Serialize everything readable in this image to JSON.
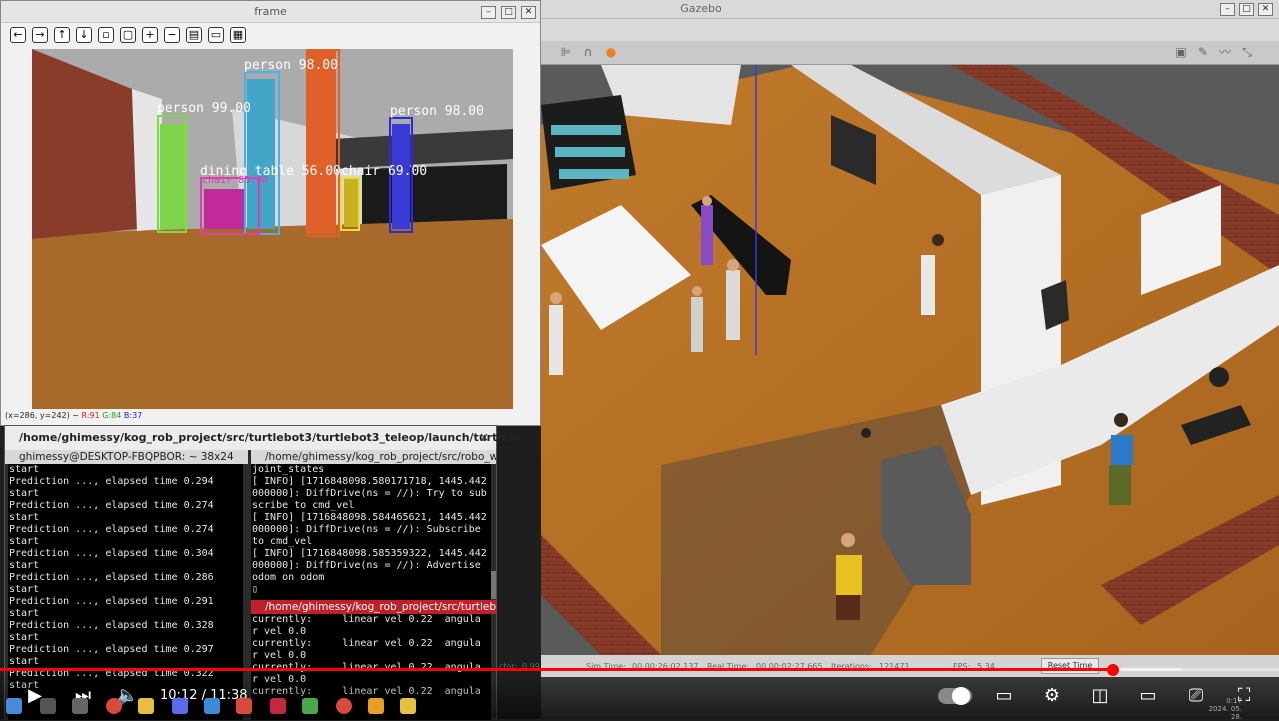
{
  "gazebo": {
    "title": "Gazebo",
    "status": {
      "factor_label": "ctor:",
      "factor_value": "0.99",
      "sim_time_label": "Sim Time:",
      "sim_time_value": "00 00:26:02.137",
      "real_time_label": "Real Time:",
      "real_time_value": "00 00:02:27.665",
      "iterations_label": "Iterations:",
      "iterations_value": "121471",
      "fps_label": "FPS:",
      "fps_value": "5.34",
      "reset_label": "Reset Time"
    }
  },
  "frame": {
    "title": "frame",
    "pixel_info": {
      "coords": "(x=286, y=242) ~",
      "r": "R:91",
      "g": "G:84",
      "b": "B:37"
    },
    "detections": [
      {
        "label": "person 99.00",
        "color": "#7cdc3a"
      },
      {
        "label": "person 98.00",
        "color": "#43b4e8"
      },
      {
        "label": "person 98.00",
        "color": "#2a2ad6"
      },
      {
        "label": "dining table 56.00",
        "color": "#e03cb4"
      },
      {
        "label": "chair 69.00",
        "color": "#e8e030"
      },
      {
        "label": "chair 85.00",
        "color": "#e03cb4"
      }
    ]
  },
  "terminal": {
    "title": "/home/ghimessy/kog_rob_project/src/turtlebot3/turtlebot3_teleop/launch/turtleb...",
    "close": "×",
    "left_pane": {
      "header": "ghimessy@DESKTOP-FBQPBOR: ~ 38x24",
      "lines": [
        "start",
        "Prediction ..., elapsed time 0.294",
        "start",
        "Prediction ..., elapsed time 0.274",
        "start",
        "Prediction ..., elapsed time 0.274",
        "start",
        "Prediction ..., elapsed time 0.304",
        "start",
        "Prediction ..., elapsed time 0.286",
        "start",
        "Prediction ..., elapsed time 0.291",
        "start",
        "Prediction ..., elapsed time 0.328",
        "start",
        "Prediction ..., elapsed time 0.297",
        "start",
        "Prediction ..., elapsed time 0.322",
        "start"
      ]
    },
    "right_top_pane": {
      "header": "/home/ghimessy/kog_rob_project/src/robo_worl",
      "lines": [
        "joint_states",
        "[ INFO] [1716848098.580171718, 1445.442",
        "000000]: DiffDrive(ns = //): Try to sub",
        "scribe to cmd_vel",
        "[ INFO] [1716848098.584465621, 1445.442",
        "000000]: DiffDrive(ns = //): Subscribe",
        "to cmd_vel",
        "[ INFO] [1716848098.585359322, 1445.442",
        "000000]: DiffDrive(ns = //): Advertise",
        "odom on odom",
        "▯"
      ]
    },
    "right_bottom_pane": {
      "header": "/home/ghimessy/kog_rob_project/src/turtlebot3",
      "lines": [
        "currently:     linear vel 0.22  angula",
        "r vel 0.0",
        "currently:     linear vel 0.22  angula",
        "r vel 0.0",
        "currently:     linear vel 0.22  angula",
        "r vel 0.0",
        "currently:     linear vel 0.22  angula"
      ]
    }
  },
  "player": {
    "time": "10:12 / 11:38",
    "progress": 0.87
  },
  "clock": {
    "time": "0:17",
    "date": "2024. 05. 28."
  }
}
